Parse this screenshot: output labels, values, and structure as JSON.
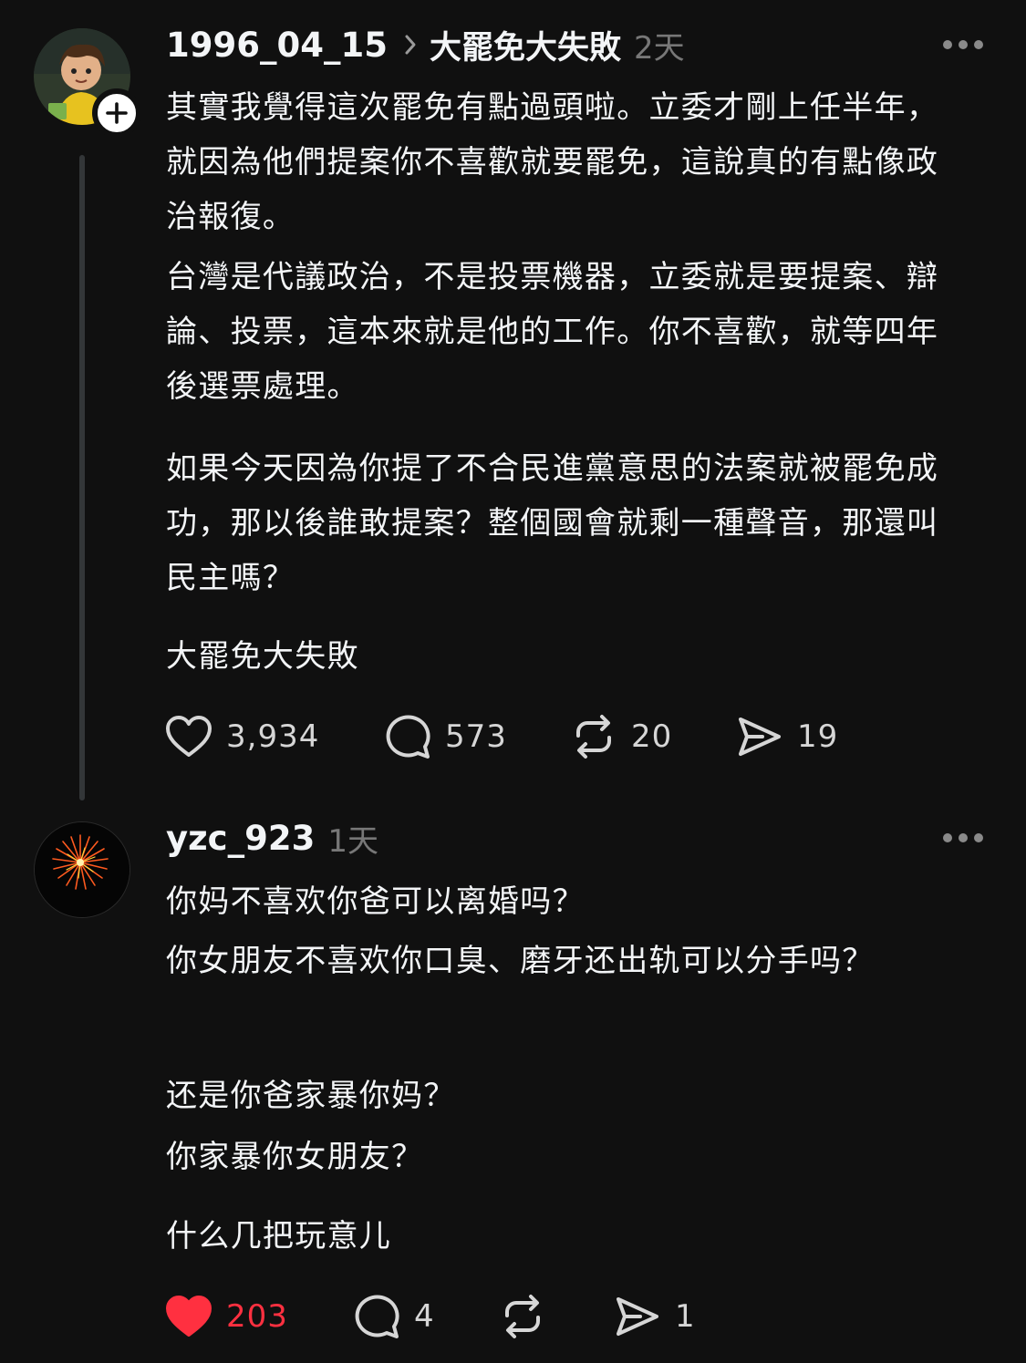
{
  "post1": {
    "username": "1996_04_15",
    "thread_title": "大罷免大失敗",
    "time": "2天",
    "paragraphs": [
      "其實我覺得這次罷免有點過頭啦。立委才剛上任半年，就因為他們提案你不喜歡就要罷免，這說真的有點像政治報復。",
      "台灣是代議政治，不是投票機器，立委就是要提案、辯論、投票，這本來就是他的工作。你不喜歡，就等四年後選票處理。",
      "如果今天因為你提了不合民進黨意思的法案就被罷免成功，那以後誰敢提案？整個國會就剩一種聲音，那還叫民主嗎？",
      "大罷免大失敗"
    ],
    "likes": "3,934",
    "replies": "573",
    "reposts": "20",
    "shares": "19"
  },
  "post2": {
    "username": "yzc_923",
    "time": "1天",
    "paragraphs": [
      "你妈不喜欢你爸可以离婚吗？",
      "你女朋友不喜欢你口臭、磨牙还出轨可以分手吗？",
      "还是你爸家暴你妈？",
      "你家暴你女朋友？",
      "什么几把玩意儿"
    ],
    "likes": "203",
    "replies": "4",
    "reposts": "",
    "shares": "1"
  },
  "colors": {
    "background": "#101010",
    "text": "#f3f5f7",
    "muted": "#777777",
    "like_active": "#ff3040"
  },
  "icons": [
    "heart-icon",
    "comment-icon",
    "repost-icon",
    "share-icon",
    "more-icon",
    "chevron-right-icon",
    "plus-icon"
  ]
}
